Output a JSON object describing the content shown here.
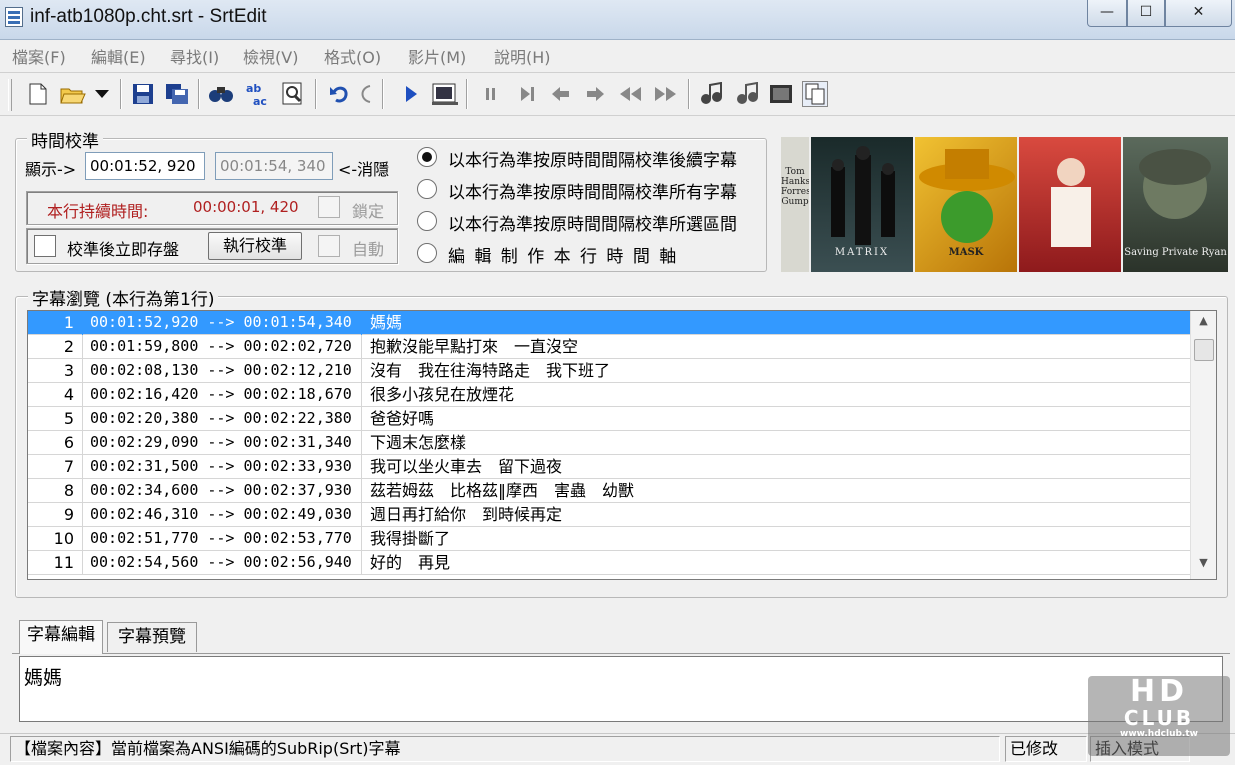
{
  "window": {
    "title": "inf-atb1080p.cht.srt - SrtEdit",
    "min_glyph": "—",
    "max_glyph": "☐",
    "close_glyph": "✕"
  },
  "menu": [
    {
      "label": "檔案(F)"
    },
    {
      "label": "編輯(E)"
    },
    {
      "label": "尋找(I)"
    },
    {
      "label": "檢視(V)"
    },
    {
      "label": "格式(O)"
    },
    {
      "label": "影片(M)"
    },
    {
      "label": "說明(H)"
    }
  ],
  "toolbar": {
    "icons": [
      "new-file-icon",
      "open-folder-icon",
      "dropdown-arrow-icon",
      "save-icon",
      "save-all-icon",
      "find-icon",
      "replace-icon",
      "preview-icon",
      "undo-icon",
      "redo-icon",
      "play-icon",
      "video-frame-icon",
      "pause-icon",
      "step-forward-icon",
      "prev-icon",
      "next-icon",
      "rewind-icon",
      "fast-forward-icon",
      "mark-start-icon",
      "mark-end-icon",
      "film-icon",
      "copy-icon"
    ]
  },
  "calibration": {
    "legend": "時間校準",
    "display_label": "顯示->",
    "start_value": "00:01:52, 920",
    "end_value": "00:01:54, 340",
    "hide_label": "<-消隱",
    "duration_label": "本行持續時間:",
    "duration_value": "00:00:01, 420",
    "lock_label": "鎖定",
    "save_after_label": "校準後立即存盤",
    "execute_label": "執行校準",
    "auto_label": "自動",
    "accent_color": "#b02020"
  },
  "radios": [
    {
      "label": "以本行為準按原時間間隔校準後續字幕",
      "checked": true
    },
    {
      "label": "以本行為準按原時間間隔校準所有字幕",
      "checked": false
    },
    {
      "label": "以本行為準按原時間間隔校準所選區間",
      "checked": false
    },
    {
      "label": "編 輯 制 作 本 行 時 間 軸",
      "checked": false
    }
  ],
  "posters": [
    {
      "caption": "Tom Hanks Forrest Gump",
      "color": "#6a7f8a"
    },
    {
      "caption": "MATRIX",
      "color": "#2b3a3c"
    },
    {
      "caption": "MASK",
      "color": "#c98c1a"
    },
    {
      "caption": "",
      "color": "#b8292a"
    },
    {
      "caption": "Saving Private Ryan",
      "color": "#5a6655"
    }
  ],
  "list": {
    "legend": "字幕瀏覽 (本行為第1行)",
    "selected_color": "#3399ff",
    "rows": [
      {
        "num": "1",
        "start": "00:01:52,920",
        "arrow": "-->",
        "end": "00:01:54,340",
        "text": "媽媽"
      },
      {
        "num": "2",
        "start": "00:01:59,800",
        "arrow": "-->",
        "end": "00:02:02,720",
        "text": "抱歉沒能早點打來　一直沒空"
      },
      {
        "num": "3",
        "start": "00:02:08,130",
        "arrow": "-->",
        "end": "00:02:12,210",
        "text": "沒有　我在往海特路走　我下班了"
      },
      {
        "num": "4",
        "start": "00:02:16,420",
        "arrow": "-->",
        "end": "00:02:18,670",
        "text": "很多小孩兒在放煙花"
      },
      {
        "num": "5",
        "start": "00:02:20,380",
        "arrow": "-->",
        "end": "00:02:22,380",
        "text": "爸爸好嗎"
      },
      {
        "num": "6",
        "start": "00:02:29,090",
        "arrow": "-->",
        "end": "00:02:31,340",
        "text": "下週末怎麼樣"
      },
      {
        "num": "7",
        "start": "00:02:31,500",
        "arrow": "-->",
        "end": "00:02:33,930",
        "text": "我可以坐火車去　留下過夜"
      },
      {
        "num": "8",
        "start": "00:02:34,600",
        "arrow": "-->",
        "end": "00:02:37,930",
        "text": "茲若姆茲　比格茲‖摩西　害蟲　幼獸"
      },
      {
        "num": "9",
        "start": "00:02:46,310",
        "arrow": "-->",
        "end": "00:02:49,030",
        "text": "週日再打給你　到時候再定"
      },
      {
        "num": "10",
        "start": "00:02:51,770",
        "arrow": "-->",
        "end": "00:02:53,770",
        "text": "我得掛斷了"
      },
      {
        "num": "11",
        "start": "00:02:54,560",
        "arrow": "-->",
        "end": "00:02:56,940",
        "text": "好的　再見"
      }
    ]
  },
  "tabs": [
    {
      "label": "字幕編輯",
      "active": true
    },
    {
      "label": "字幕預覽",
      "active": false
    }
  ],
  "editor": {
    "text": "媽媽"
  },
  "status": {
    "file_info": "【檔案內容】當前檔案為ANSI編碼的SubRip(Srt)字幕",
    "modified": "已修改",
    "mode": "插入模式"
  },
  "watermark": {
    "line1": "HD",
    "line2": "CLUB",
    "site": "www.hdclub.tw"
  }
}
